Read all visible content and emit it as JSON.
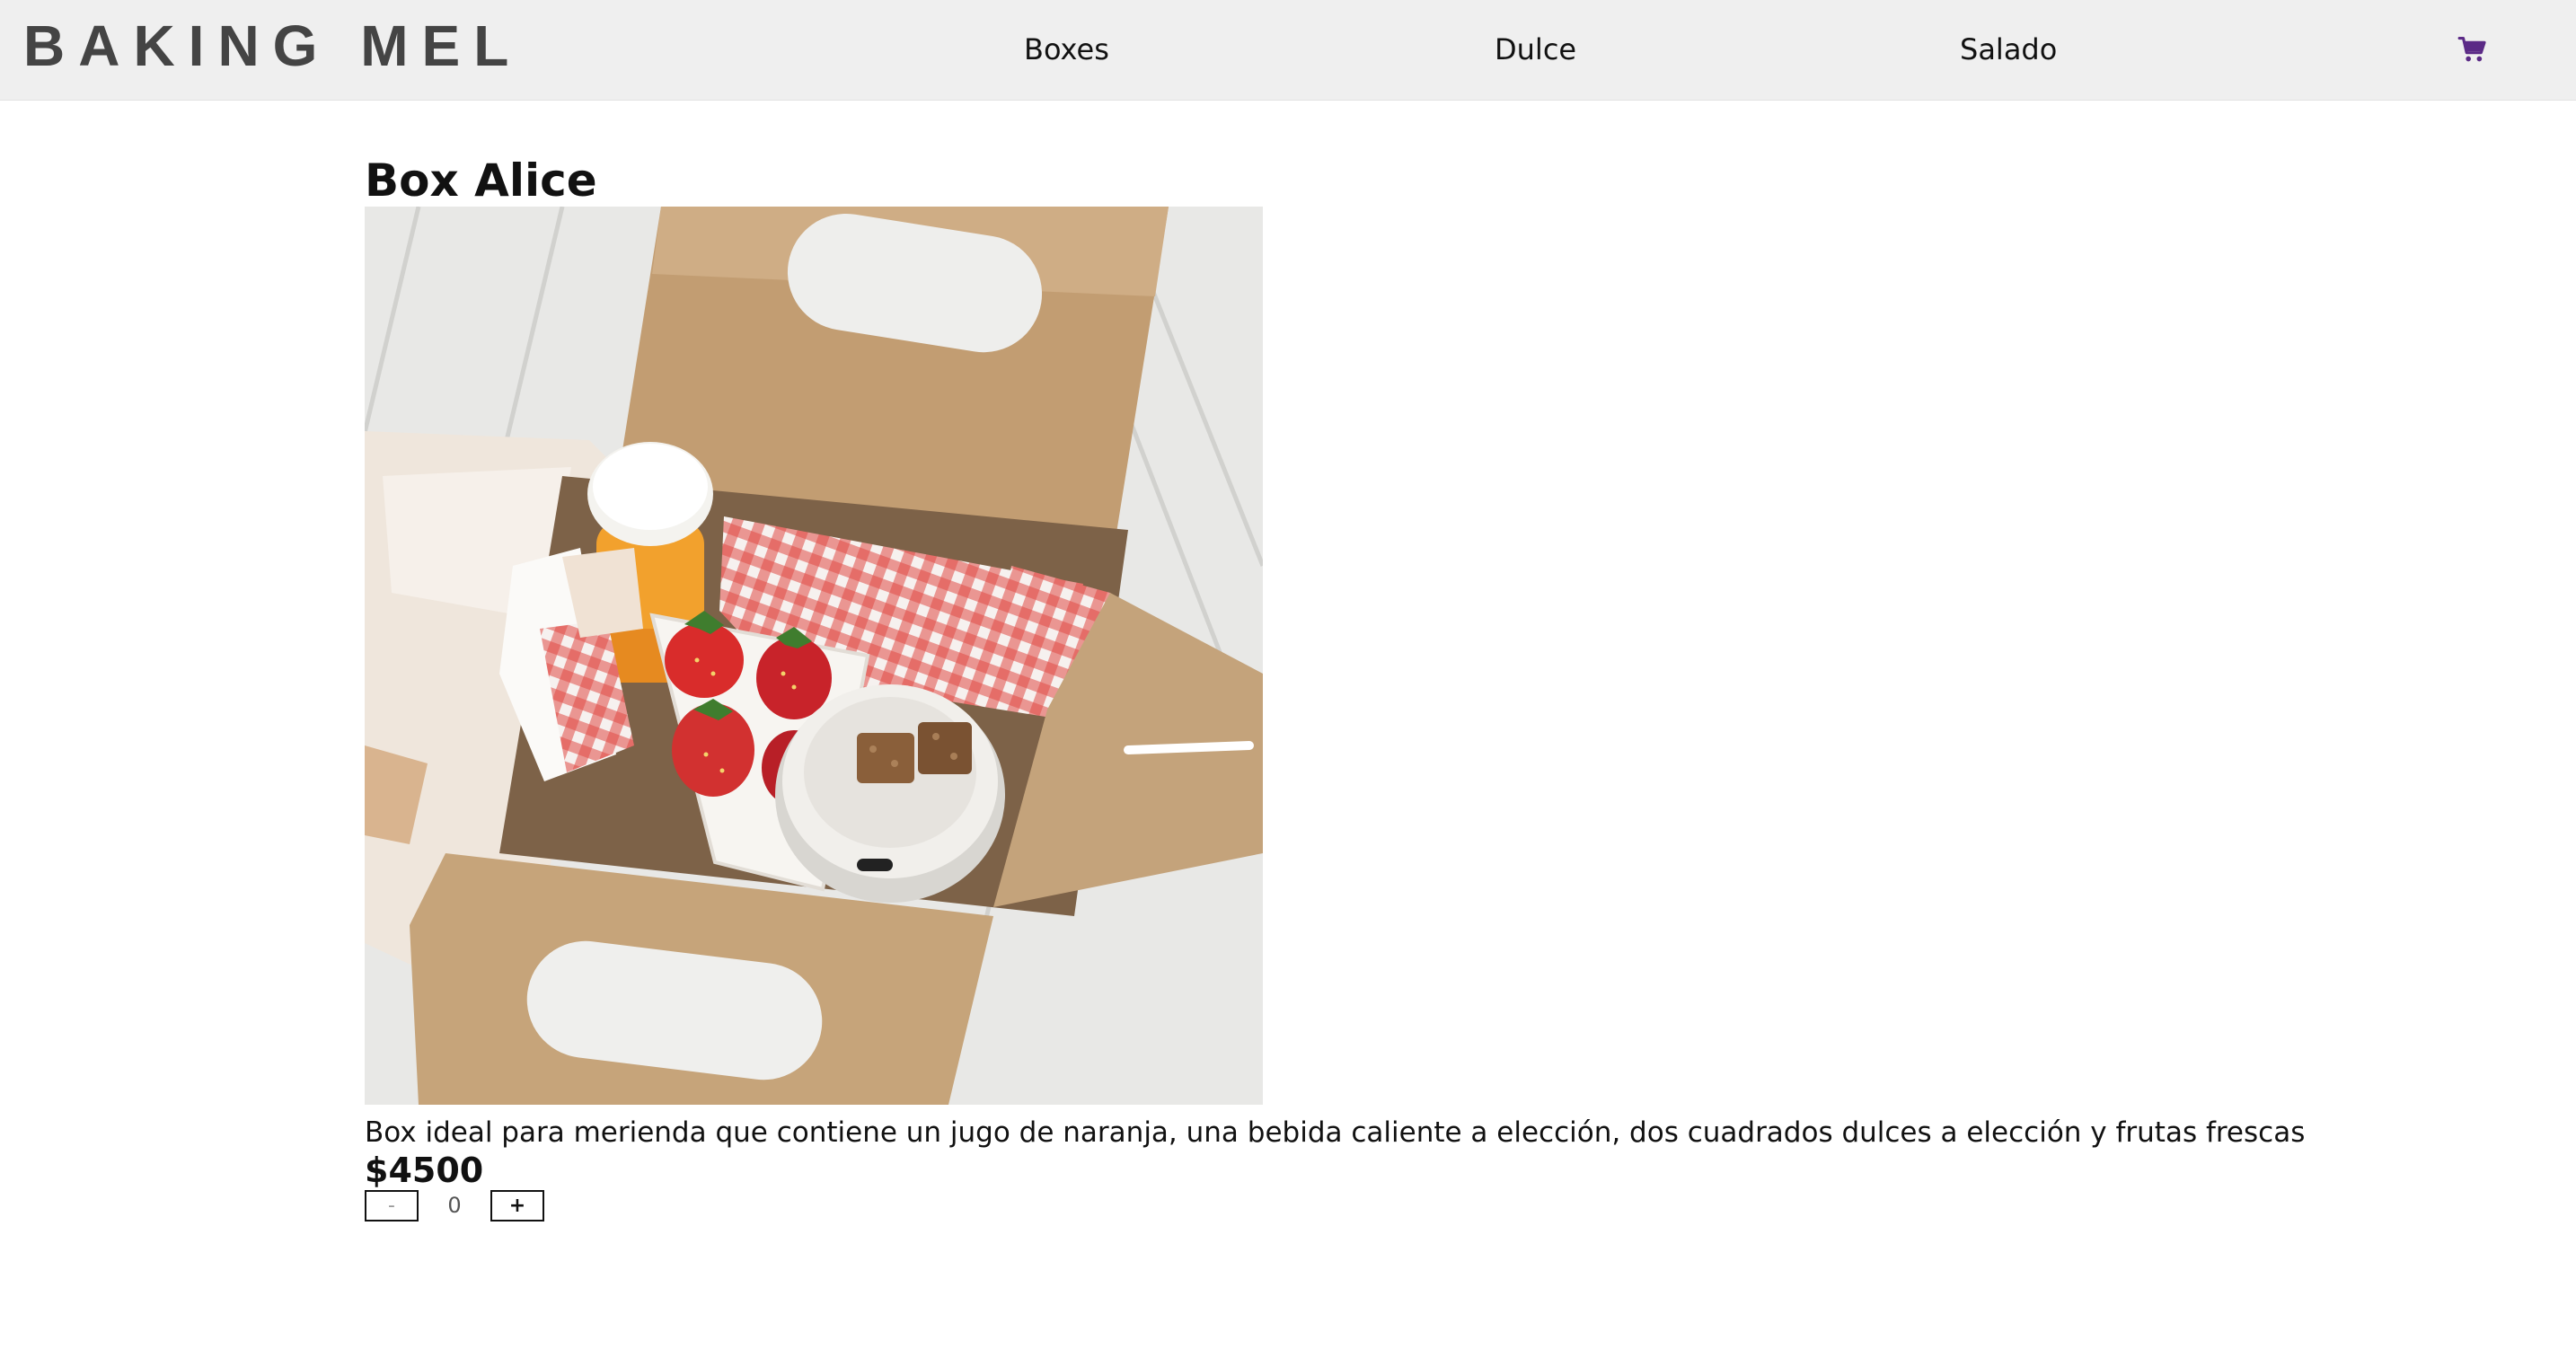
{
  "header": {
    "brand": "BAKING MEL",
    "nav": [
      "Boxes",
      "Dulce",
      "Salado"
    ],
    "cart_icon": "shopping-cart-icon",
    "accent_color": "#5b2a86"
  },
  "product": {
    "title": "Box Alice",
    "description": "Box ideal para merienda que contiene un jugo de naranja, una bebida caliente a elección, dos cuadrados dulces a elección y frutas frescas",
    "price": "$4500",
    "quantity": {
      "decrement_label": "-",
      "value": "0",
      "increment_label": "+"
    }
  }
}
